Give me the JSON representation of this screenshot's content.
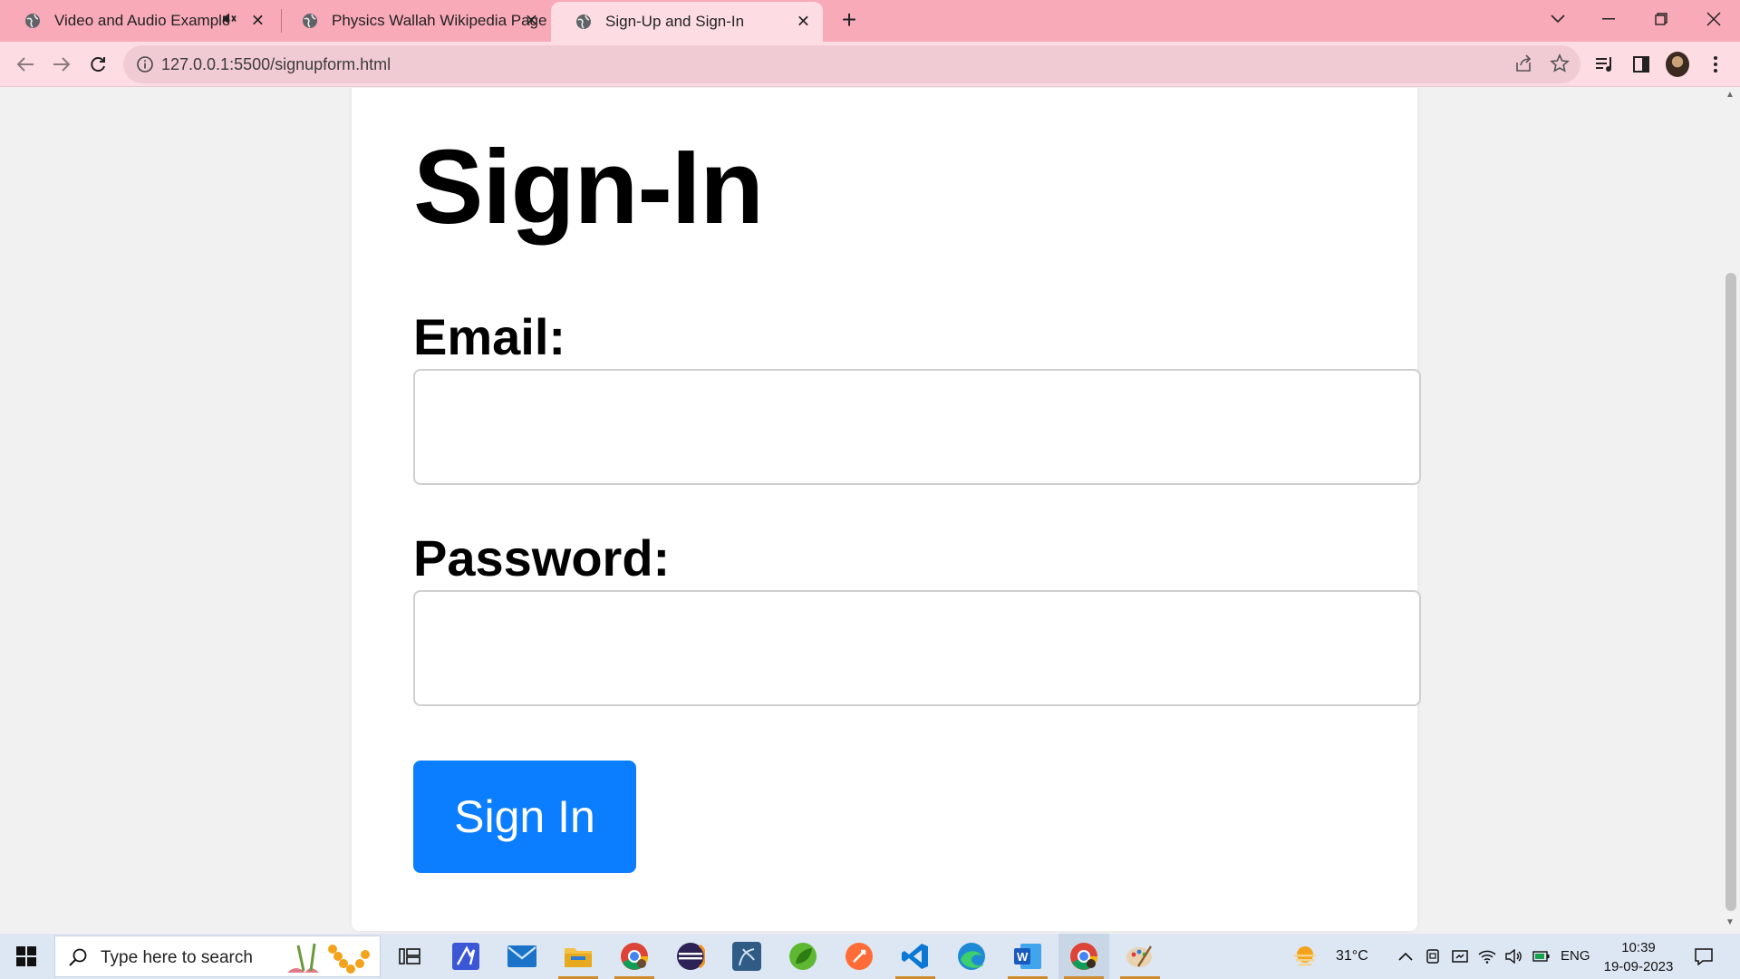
{
  "browser": {
    "tabs": [
      {
        "title": "Video and Audio Example",
        "muted_indicator": true,
        "active": false
      },
      {
        "title": "Physics Wallah Wikipedia Page",
        "active": false
      },
      {
        "title": "Sign-Up and Sign-In",
        "active": true
      }
    ],
    "close_glyph": "✕",
    "new_tab_glyph": "+",
    "window_controls": {
      "tab_search": "chevron-down-icon",
      "minimize": "—",
      "restore": "❐",
      "close": "✕"
    },
    "url": "127.0.0.1:5500/signupform.html"
  },
  "page": {
    "title": "Sign-In",
    "email_label": "Email:",
    "email_value": "",
    "password_label": "Password:",
    "password_value": "",
    "submit_label": "Sign In"
  },
  "taskbar": {
    "search_placeholder": "Type here to search",
    "weather_temp": "31°C",
    "language": "ENG",
    "time": "10:39",
    "date": "19-09-2023"
  },
  "colors": {
    "tab_strip": "#f9aab9",
    "toolbar": "#fddde3",
    "button_primary": "#0b7dff",
    "taskbar": "#dde7f3"
  }
}
